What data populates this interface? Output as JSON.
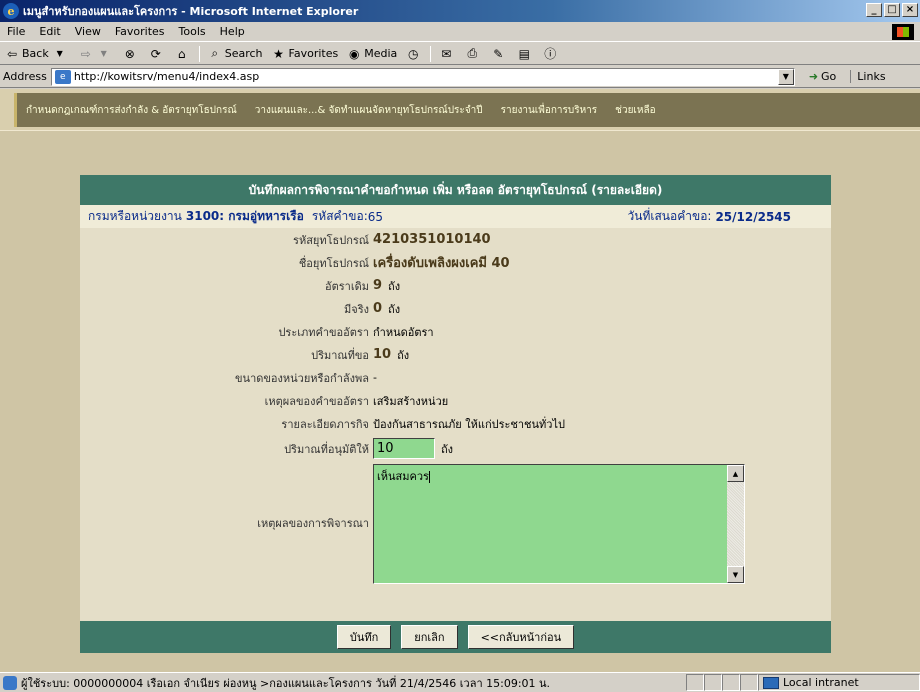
{
  "window": {
    "title": "เมนูสำหรับกองแผนและโครงการ - Microsoft Internet Explorer",
    "min": "_",
    "max": "□",
    "close": "×"
  },
  "menubar": [
    "File",
    "Edit",
    "View",
    "Favorites",
    "Tools",
    "Help"
  ],
  "toolbar": {
    "back": "Back",
    "search": "Search",
    "favorites": "Favorites",
    "media": "Media"
  },
  "address": {
    "label": "Address",
    "url": "http://kowitsrv/menu4/index4.asp",
    "go": "Go",
    "links": "Links"
  },
  "nav": [
    "กำหนดกฎเกณฑ์การส่งกำลัง & อัตรายุทโธปกรณ์",
    "วางแผนและ...& จัดทำแผนจัดหายุทโธปกรณ์ประจำปี",
    "รายงานเพื่อการบริหาร",
    "ช่วยเหลือ"
  ],
  "form": {
    "title": "บันทึกผลการพิจารณาคำขอกำหนด เพิ่ม หรือลด อัตรายุทโธปกรณ์ (รายละเอียด)",
    "dept_label": "กรมหรือหน่วยงาน",
    "dept_value": "3100: กรมอู่ทหารเรือ",
    "req_label": "รหัสคำขอ:",
    "req_value": "65",
    "date_label": "วันที่เสนอคำขอ:",
    "date_value": "25/12/2545",
    "fields": {
      "equip_code": {
        "label": "รหัสยุทโธปกรณ์",
        "value": "4210351010140"
      },
      "equip_name": {
        "label": "ชื่อยุทโธปกรณ์",
        "value": "เครื่องดับเพลิงผงเคมี 40"
      },
      "orig_rate": {
        "label": "อัตราเดิม",
        "value": "9",
        "unit": "ถัง"
      },
      "actual": {
        "label": "มีจริง",
        "value": "0",
        "unit": "ถัง"
      },
      "req_type": {
        "label": "ประเภทคำขออัตรา",
        "value": "กำหนดอัตรา"
      },
      "req_qty": {
        "label": "ปริมาณที่ขอ",
        "value": "10",
        "unit": "ถัง"
      },
      "unit_size": {
        "label": "ขนาดของหน่วยหรือกำลังพล",
        "value": "-"
      },
      "reason": {
        "label": "เหตุผลของคำขออัตรา",
        "value": "เสริมสร้างหน่วย"
      },
      "mission": {
        "label": "รายละเอียดภารกิจ",
        "value": "ป้องกันสาธารณภัย ให้แก่ประชาชนทั่วไป"
      },
      "approved_qty": {
        "label": "ปริมาณที่อนุมัติให้",
        "value": "10",
        "unit": "ถัง"
      },
      "consider_reason": {
        "label": "เหตุผลของการพิจารณา",
        "value": "เห็นสมควร"
      }
    },
    "buttons": {
      "save": "บันทึก",
      "cancel": "ยกเลิก",
      "back": "<<กลับหน้าก่อน"
    }
  },
  "status": {
    "text": "ผู้ใช้ระบบ: 0000000004 เรือเอก จำเนียร ผ่องหนู >กองแผนและโครงการ วันที่ 21/4/2546 เวลา 15:09:01 น.",
    "zone": "Local intranet"
  }
}
